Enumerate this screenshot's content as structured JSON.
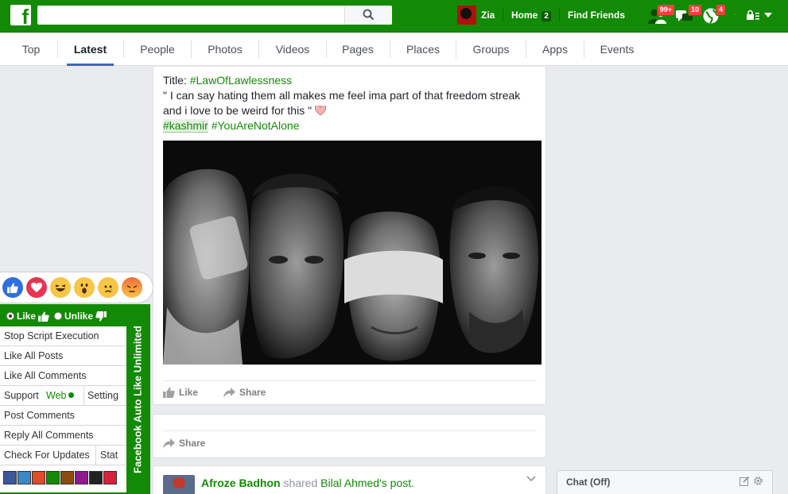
{
  "topbar": {
    "logo": "f",
    "search_placeholder": "",
    "user_name": "Zia",
    "home_label": "Home",
    "home_count": "2",
    "find_friends_label": "Find Friends",
    "friend_requests_badge": "99+",
    "messages_badge": "10",
    "notifications_badge": "4",
    "brand_color": "#138a05"
  },
  "tabs": [
    {
      "label": "Top"
    },
    {
      "label": "Latest",
      "active": true
    },
    {
      "label": "People"
    },
    {
      "label": "Photos"
    },
    {
      "label": "Videos"
    },
    {
      "label": "Pages"
    },
    {
      "label": "Places"
    },
    {
      "label": "Groups"
    },
    {
      "label": "Apps"
    },
    {
      "label": "Events"
    }
  ],
  "post": {
    "title_prefix": "Title: ",
    "title_tag": "#LawOfLawlessness",
    "quote_line1": "\" I can say hating them all makes me feel ima part of that freedom streak",
    "quote_line2": "and i love to be weird for this \"",
    "tag1": "#kashmir",
    "tag2": "#YouAreNotAlone",
    "like_label": "Like",
    "share_label": "Share"
  },
  "share_card": {
    "share_label": "Share"
  },
  "next_post": {
    "author": "Afroze Badhon",
    "verb": " shared ",
    "target": "Bilal Ahmed",
    "suffix": "'s post."
  },
  "chat": {
    "title": "Chat (Off)"
  },
  "reactions": [
    "like",
    "love",
    "haha",
    "wow",
    "sad",
    "angry"
  ],
  "panel": {
    "like_label": "Like",
    "unlike_label": "Unlike",
    "side_title": "Facebook Auto Like Unlimited",
    "stop_script": "Stop Script Execution",
    "like_all_posts": "Like All Posts",
    "like_all_comments": "Like All Comments",
    "support": "Support",
    "web": "Web",
    "setting": "Setting",
    "post_comments": "Post Comments",
    "reply_all_comments": "Reply All Comments",
    "check_updates": "Check For Updates",
    "stat": "Stat",
    "swatch_colors": [
      "#3b5998",
      "#3a88c4",
      "#e04c2a",
      "#138a05",
      "#8a4a10",
      "#8e1a8e",
      "#222222",
      "#d6213c"
    ]
  }
}
